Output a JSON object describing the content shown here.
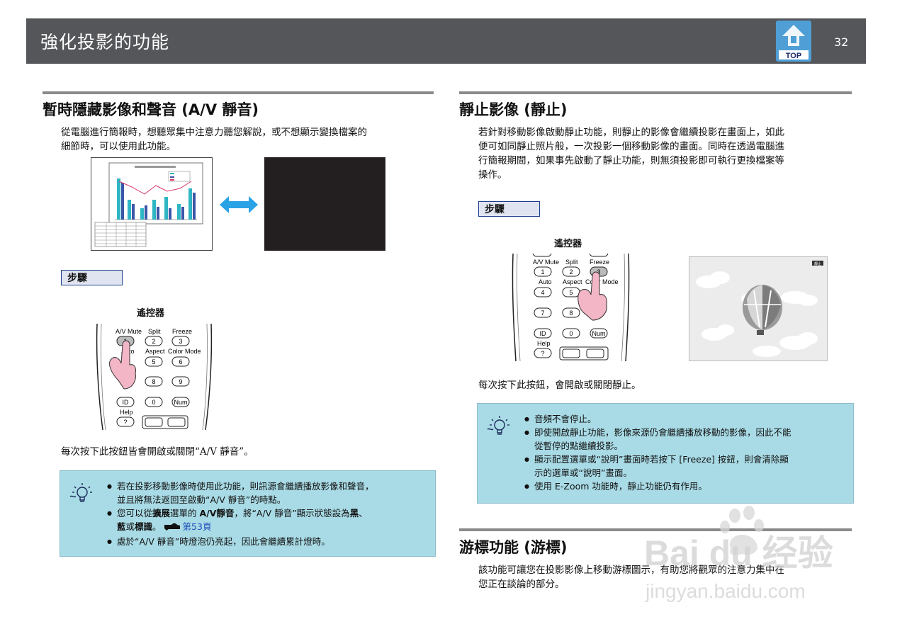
{
  "header": {
    "title": "強化投影的功能",
    "top_label": "TOP",
    "page_number": "32"
  },
  "left": {
    "heading": "暫時隱藏影像和聲音 (A/V 靜音)",
    "intro_1": "從電腦進行簡報時，想聽眾集中注意力聽您解說，或不想顯示變換檔案的",
    "intro_2": "細節時，可以使用此功能。",
    "step_label": "步驟",
    "remote_label": "遙控器",
    "remote_keys": {
      "avmute": "A/V Mute",
      "split": "Split",
      "freeze": "Freeze",
      "k1": "1",
      "k2": "2",
      "k3": "3",
      "auto": "Auto",
      "aspect": "Aspect",
      "colormode": "Color Mode",
      "k4": "4",
      "k5": "5",
      "k6": "6",
      "k7": "7",
      "k8": "8",
      "k9": "9",
      "id": "ID",
      "k0": "0",
      "num": "Num",
      "help": "Help",
      "q": "?"
    },
    "press_text": "每次按下此按鈕皆會開啟或關閉“A/V 靜音”。",
    "tips": {
      "t1a": "若在投影移動影像時使用此功能，則訊源會繼續播放影像和聲音，",
      "t1b": "並且將無法返回至啟動“A/V 靜音”的時點。",
      "t2_pre": "您可以從",
      "t2_bold1": "擴展",
      "t2_mid": "選單的 ",
      "t2_bold2": "A/V靜音",
      "t2_post": "，將“A/V 靜音”顯示狀態設為",
      "t2_bold3": "黑",
      "t2_sep": "、",
      "t2_bold4": "藍",
      "t2_or": "或",
      "t2_bold5": "標識",
      "t2_end": "。",
      "t2_link": "第53頁",
      "t3": "處於“A/V 靜音”時燈泡仍亮起，因此會繼續累計燈時。"
    }
  },
  "right": {
    "heading": "靜止影像 (靜止)",
    "intro_1": "若針對移動影像啟動靜止功能，則靜止的影像會繼續投影在畫面上，如此",
    "intro_2": "便可如同靜止照片般，一次投影一個移動影像的畫面。同時在透過電腦進",
    "intro_3": "行簡報期間，如果事先啟動了靜止功能，則無須投影即可執行更換檔案等",
    "intro_4": "操作。",
    "step_label": "步驟",
    "remote_label": "遙控器",
    "freeze_badge": "靜止",
    "press_text": "每次按下此按鈕，會開啟或關閉靜止。",
    "tips": {
      "t1": "音頻不會停止。",
      "t2a": "即使開啟靜止功能，影像來源仍會繼續播放移動的影像，因此不能",
      "t2b": "從暫停的點繼續投影。",
      "t3a": "顯示配置選單或“說明”畫面時若按下 [Freeze] 按鈕，則會清除顯",
      "t3b": "示的選單或“說明”畫面。",
      "t4": "使用 E-Zoom 功能時，靜止功能仍有作用。"
    },
    "heading2": "游標功能 (游標)",
    "pointer_1": "該功能可讓您在投影影像上移動游標圖示，有助您將觀眾的注意力集中在",
    "pointer_2": "您正在談論的部分。"
  },
  "watermark": {
    "main": "Bai du 经验",
    "url": "jingyan.baidu.com"
  },
  "colors": {
    "header_bg": "#55565a",
    "tip_bg": "#a9dbe6",
    "step_border": "#1f3f8f",
    "arrow": "#2aa2e6"
  }
}
